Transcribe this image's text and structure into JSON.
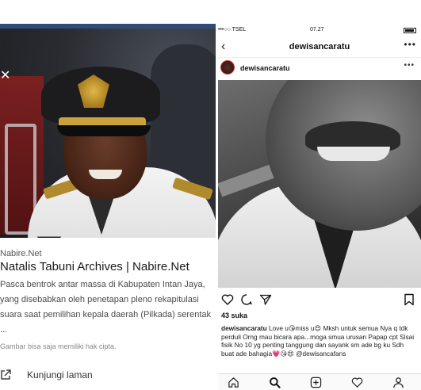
{
  "left": {
    "site": "Nabire.Net",
    "title": "Natalis Tabuni Archives | Nabire.Net",
    "description": "Pasca bentrok antar massa di Kabupaten Intan Jaya, yang disebabkan oleh penetapan pleno rekapitulasi suara saat pemilihan kepala daerah (Pilkada) serentak ...",
    "image_note": "Gambar bisa saja memiliki hak cipta.",
    "visit_label": "Kunjungi laman",
    "icons": [
      "close-icon",
      "external-link-icon"
    ]
  },
  "right": {
    "status": {
      "carrier": "•••○○ TSEL",
      "time": "07.27"
    },
    "header_title": "dewisancaratu",
    "post_user": "dewisancaratu",
    "likes": "43 suka",
    "caption_user": "dewisancaratu",
    "caption_text": "Love u😘miss u😍 Mksh untuk semua Nya q tdk perduli Orng mau bicara apa...moga smua urusan Papap cpt Slsai fisik No 10 yg penting tanggung dan sayank sm ade bg ku Sdh buat ade bahagia💗😘😍 @dewisancafans",
    "icons": [
      "back-icon",
      "more-icon",
      "heart-icon",
      "comment-icon",
      "share-icon",
      "bookmark-icon",
      "home-icon",
      "search-icon",
      "add-icon",
      "activity-icon",
      "profile-icon"
    ]
  }
}
